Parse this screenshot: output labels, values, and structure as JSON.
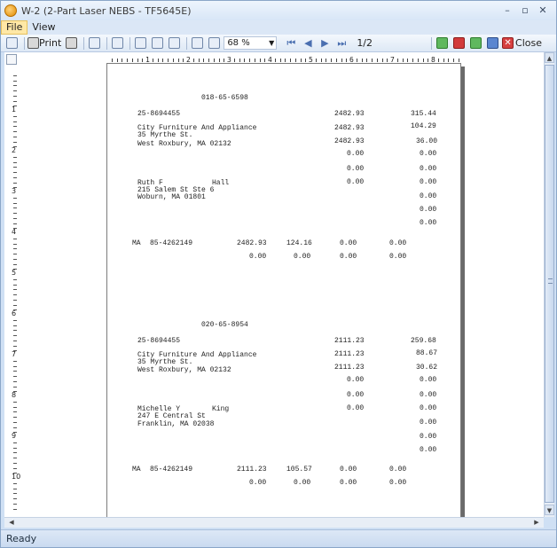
{
  "window": {
    "title": "W-2 (2-Part Laser NEBS - TF5645E)",
    "controls": [
      "–",
      "▫",
      "✕"
    ]
  },
  "menu": [
    "File",
    "View"
  ],
  "toolbar": {
    "print_label": "Print",
    "zoom_value": "68 %",
    "page_indicator": "1/2",
    "close_label": "Close"
  },
  "ruler": {
    "h_numbers": [
      "1",
      "2",
      "3",
      "4",
      "5",
      "6",
      "7",
      "8"
    ],
    "v_numbers": [
      "1",
      "2",
      "3",
      "4",
      "5",
      "6",
      "7",
      "8",
      "9",
      "10"
    ]
  },
  "forms": [
    {
      "ssn": "018-65-6598",
      "ein": "25-8694455",
      "employer": [
        "City Furniture And Appliance",
        "35 Myrthe St.",
        "West Roxbury, MA 02132"
      ],
      "employee_first": "Ruth F",
      "employee_last": "Hall",
      "employee_addr": [
        "215 Salem St Ste 6",
        "Woburn, MA 01801"
      ],
      "col1": [
        "2482.93",
        "2482.93",
        "2482.93",
        "0.00",
        "0.00",
        "0.00"
      ],
      "col2": [
        "315.44",
        "104.29",
        "36.00",
        "0.00",
        "0.00",
        "0.00",
        "0.00",
        "0.00",
        "0.00"
      ],
      "state": "MA",
      "state_id": "85-4262149",
      "state_row": [
        "2482.93",
        "124.16",
        "0.00",
        "0.00"
      ],
      "local_row": [
        "0.00",
        "0.00",
        "0.00",
        "0.00"
      ]
    },
    {
      "ssn": "020-65-8954",
      "ein": "25-8694455",
      "employer": [
        "City Furniture And Appliance",
        "35 Myrthe St.",
        "West Roxbury, MA 02132"
      ],
      "employee_first": "Michelle Y",
      "employee_last": "King",
      "employee_addr": [
        "247 E Central St",
        "Franklin, MA 02038"
      ],
      "col1": [
        "2111.23",
        "2111.23",
        "2111.23",
        "0.00",
        "0.00",
        "0.00"
      ],
      "col2": [
        "259.68",
        "88.67",
        "30.62",
        "0.00",
        "0.00",
        "0.00",
        "0.00",
        "0.00",
        "0.00"
      ],
      "state": "MA",
      "state_id": "85-4262149",
      "state_row": [
        "2111.23",
        "105.57",
        "0.00",
        "0.00"
      ],
      "local_row": [
        "0.00",
        "0.00",
        "0.00",
        "0.00"
      ]
    }
  ],
  "status": "Ready"
}
